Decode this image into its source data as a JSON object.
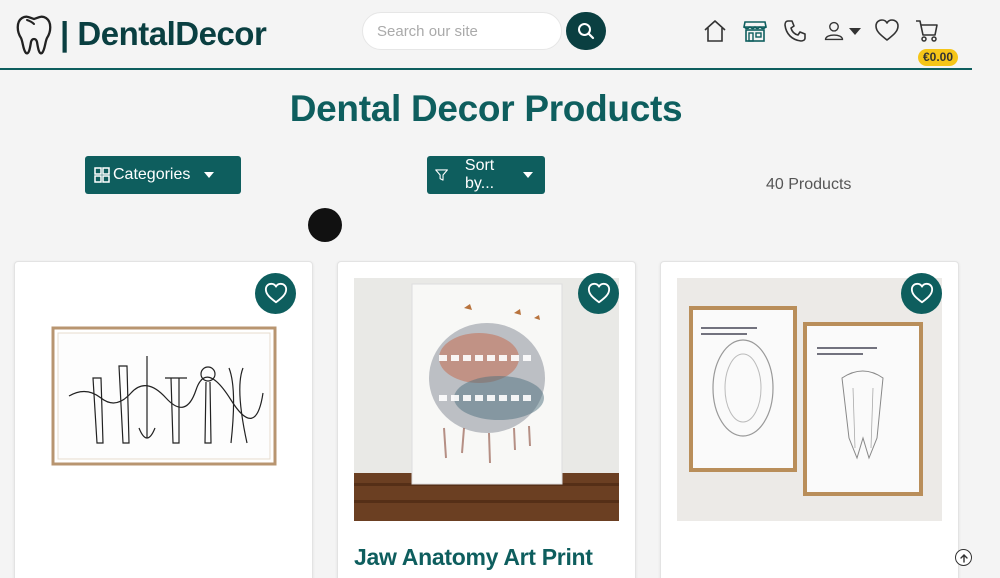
{
  "brand": {
    "name": "| DentalDecor"
  },
  "search": {
    "placeholder": "Search our site"
  },
  "nav": {
    "icons": [
      "home-icon",
      "store-icon",
      "phone-icon",
      "user-icon",
      "heart-icon",
      "cart-icon"
    ],
    "cart_total": "€0.00"
  },
  "page": {
    "title": "Dental Decor Products"
  },
  "toolbar": {
    "categories_label": "Categories",
    "sort_label": "Sort by...",
    "product_count": "40 Products"
  },
  "colors": {
    "teal": "#0e5e5e",
    "teal_dark": "#0a3f41",
    "badge": "#f5c518"
  },
  "products": [
    {
      "title": "",
      "image": "dental-tools-line-art"
    },
    {
      "title": "Jaw Anatomy Art Print",
      "image": "jaw-anatomy-watercolor"
    },
    {
      "title": "",
      "image": "dental-charts-framed"
    }
  ]
}
